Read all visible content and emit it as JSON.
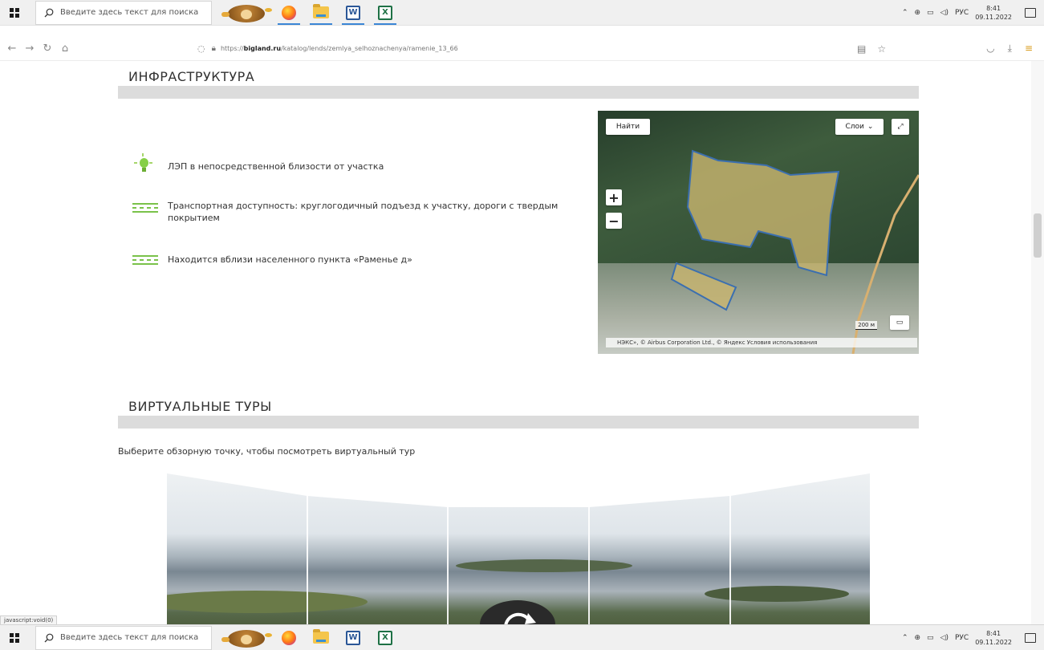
{
  "taskbar": {
    "search_placeholder": "Введите здесь текст для поиска",
    "lang": "РУС",
    "time": "8:41",
    "date": "09.11.2022",
    "apps": [
      "firefox-icon",
      "file-explorer-icon",
      "word-icon",
      "excel-icon"
    ]
  },
  "browser": {
    "url_prefix": "https://",
    "url_host": "bigland.ru",
    "url_path": "/katalog/lends/zemlya_selhoznachenya/ramenie_13_66"
  },
  "infrastructure": {
    "title": "ИНФРАСТРУКТУРА",
    "features": [
      {
        "icon": "lightbulb-icon",
        "text": "ЛЭП в непосредственной близости от участка"
      },
      {
        "icon": "road-icon",
        "text": "Транспортная доступность: круглогодичный подъезд к участку, дороги с твердым покрытием"
      },
      {
        "icon": "road-icon",
        "text": "Находится вблизи населенного пункта «Раменье д»"
      }
    ]
  },
  "map": {
    "find_label": "Найти",
    "layers_label": "Слои",
    "scale_label": "200 м",
    "attribution": "НЭКС», © Airbus Corporation Ltd., © Яндекс Условия использования"
  },
  "tours": {
    "title": "ВИРТУАЛЬНЫЕ ТУРЫ",
    "hint": "Выберите обзорную точку, чтобы посмотреть виртуальный тур"
  },
  "status_bar": {
    "link": "javascript:void(0)"
  },
  "colors": {
    "accent_green": "#7ac24a",
    "section_bar": "#dcdcdc"
  }
}
